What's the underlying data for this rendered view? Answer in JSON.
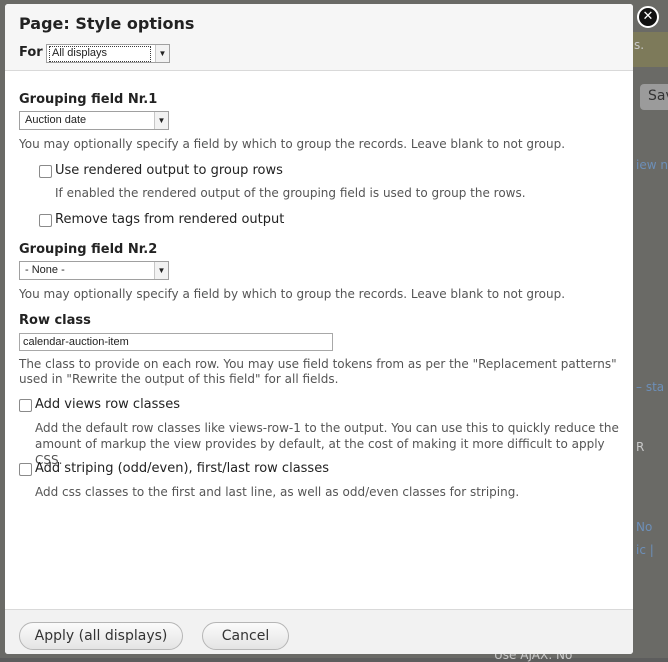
{
  "dialog": {
    "title": "Page: Style options",
    "for_label": "For",
    "for_select_value": "All displays",
    "close_icon": "close-icon"
  },
  "grouping1": {
    "label": "Grouping field Nr.1",
    "select_value": "Auction date",
    "description": "You may optionally specify a field by which to group the records. Leave blank to not group.",
    "use_rendered_label": "Use rendered output to group rows",
    "use_rendered_description": "If enabled the rendered output of the grouping field is used to group the rows.",
    "remove_tags_label": "Remove tags from rendered output"
  },
  "grouping2": {
    "label": "Grouping field Nr.2",
    "select_value": "- None -",
    "description": "You may optionally specify a field by which to group the records. Leave blank to not group."
  },
  "row_class": {
    "label": "Row class",
    "value": "calendar-auction-item",
    "description_line1": "The class to provide on each row. You may use field tokens from as per the \"Replacement patterns\"",
    "description_line2": "used in \"Rewrite the output of this field\" for all fields."
  },
  "views_row_classes": {
    "label": "Add views row classes",
    "description_line1": "Add the default row classes like views-row-1 to the output. You can use this to quickly reduce the",
    "description_line2": "amount of markup the view provides by default, at the cost of making it more difficult to apply CSS."
  },
  "striping": {
    "label": "Add striping (odd/even), first/last row classes",
    "description": "Add css classes to the first and last line, as well as odd/even classes for striping."
  },
  "footer": {
    "apply_label": "Apply (all displays)",
    "cancel_label": "Cancel"
  },
  "background": {
    "frag_s": "s.",
    "frag_sav": "Sav",
    "frag_iew_na": "iew na",
    "frag_sta": "– sta",
    "frag_r": "R",
    "frag_no": "No",
    "frag_ic": "ic  |",
    "frag_use_ajax": "Use AJAX: No"
  }
}
